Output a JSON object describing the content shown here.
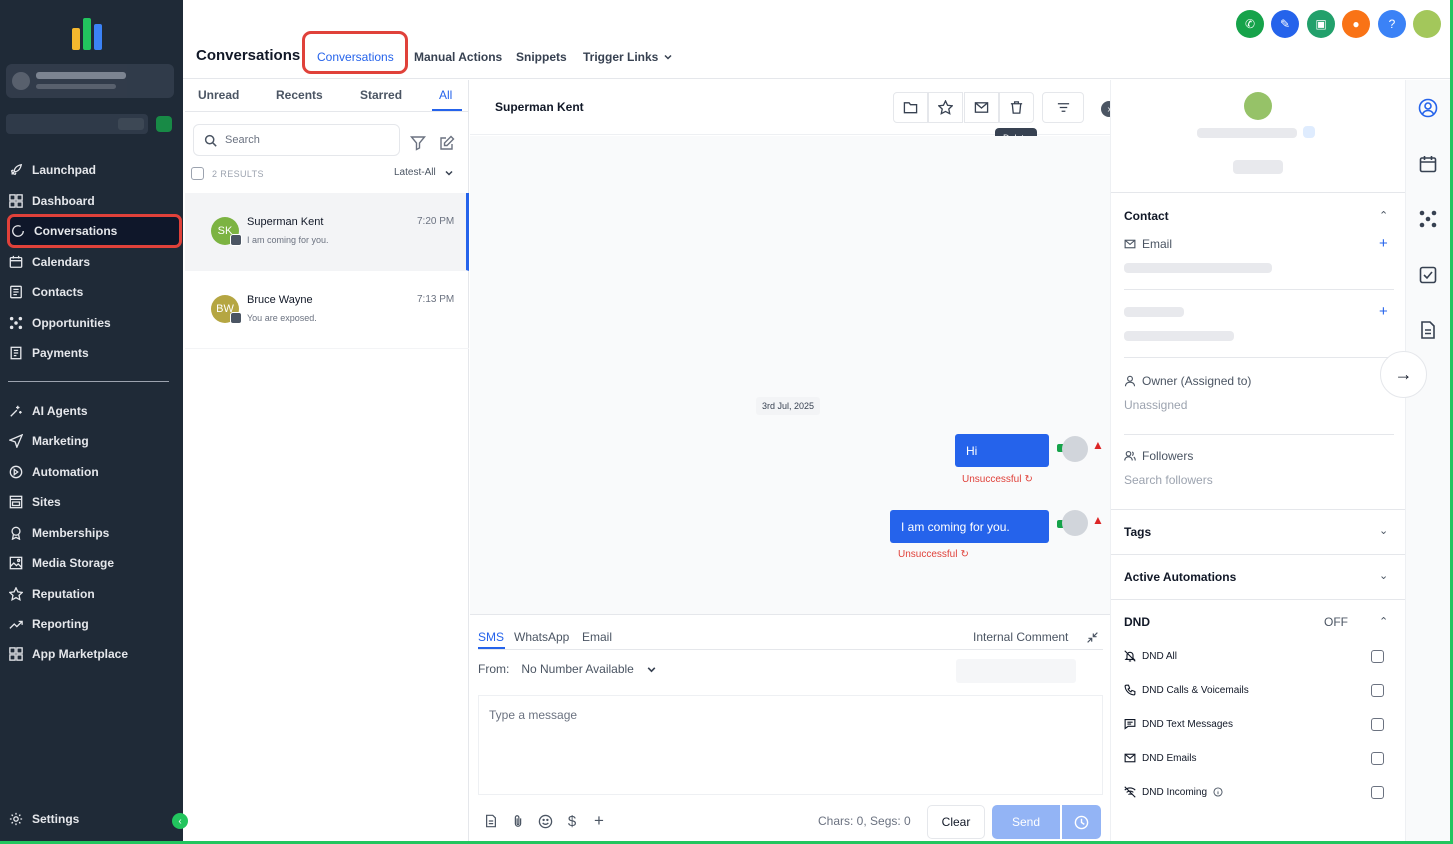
{
  "sidebar": {
    "items": [
      {
        "label": "Launchpad",
        "icon": "rocket-icon"
      },
      {
        "label": "Dashboard",
        "icon": "grid-icon"
      },
      {
        "label": "Conversations",
        "icon": "chat-icon"
      },
      {
        "label": "Calendars",
        "icon": "calendar-icon"
      },
      {
        "label": "Contacts",
        "icon": "contacts-icon"
      },
      {
        "label": "Opportunities",
        "icon": "opportunities-icon"
      },
      {
        "label": "Payments",
        "icon": "payments-icon"
      },
      {
        "label": "AI Agents",
        "icon": "ai-agents-icon"
      },
      {
        "label": "Marketing",
        "icon": "send-icon"
      },
      {
        "label": "Automation",
        "icon": "automation-icon"
      },
      {
        "label": "Sites",
        "icon": "sites-icon"
      },
      {
        "label": "Memberships",
        "icon": "memberships-icon"
      },
      {
        "label": "Media Storage",
        "icon": "media-icon"
      },
      {
        "label": "Reputation",
        "icon": "star-icon"
      },
      {
        "label": "Reporting",
        "icon": "reporting-icon"
      },
      {
        "label": "App Marketplace",
        "icon": "apps-icon"
      }
    ],
    "settings_label": "Settings"
  },
  "topbar": {
    "title": "Conversations",
    "tabs": [
      "Conversations",
      "Manual Actions",
      "Snippets",
      "Trigger Links"
    ],
    "action_colors": [
      "#16a34a",
      "#2563eb",
      "#22a06b",
      "#f97316",
      "#3b82f6",
      "#a3c75b"
    ]
  },
  "list": {
    "tabs": [
      "Unread",
      "Recents",
      "Starred",
      "All"
    ],
    "search_placeholder": "Search",
    "results": "2 RESULTS",
    "sort": "Latest-All",
    "conversations": [
      {
        "initials": "SK",
        "name": "Superman Kent",
        "preview": "I am coming for you.",
        "time": "7:20 PM",
        "color": "#7cb342"
      },
      {
        "initials": "BW",
        "name": "Bruce Wayne",
        "preview": "You are exposed.",
        "time": "7:13 PM",
        "color": "#b5a642"
      }
    ]
  },
  "chat": {
    "contact_name": "Superman Kent",
    "tooltip": "Delete",
    "date": "3rd Jul, 2025",
    "messages": [
      {
        "text": "Hi",
        "status": "Unsuccessful"
      },
      {
        "text": "I am coming for you.",
        "status": "Unsuccessful"
      }
    ],
    "composer": {
      "tabs": [
        "SMS",
        "WhatsApp",
        "Email"
      ],
      "internal_comment": "Internal Comment",
      "from_label": "From:",
      "from_value": "No Number Available",
      "placeholder": "Type a message",
      "chars": "Chars: 0, Segs: 0",
      "clear": "Clear",
      "send": "Send"
    }
  },
  "contact_panel": {
    "contact_title": "Contact",
    "email_label": "Email",
    "owner_label": "Owner (Assigned to)",
    "owner_value": "Unassigned",
    "followers_label": "Followers",
    "followers_placeholder": "Search followers",
    "tags_title": "Tags",
    "automations_title": "Active Automations",
    "dnd_title": "DND",
    "dnd_state": "OFF",
    "dnd_items": [
      "DND All",
      "DND Calls & Voicemails",
      "DND Text Messages",
      "DND Emails",
      "DND Incoming"
    ]
  }
}
